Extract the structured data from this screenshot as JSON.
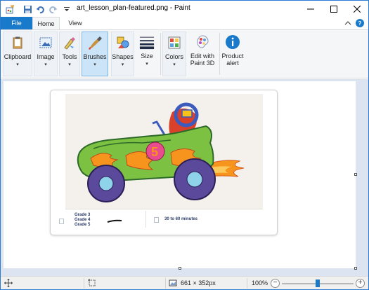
{
  "titlebar": {
    "title": "art_lesson_plan-featured.png - Paint",
    "icons": [
      "paint-app-icon",
      "save-icon",
      "undo-icon",
      "redo-icon",
      "customize-quick-access-icon"
    ],
    "window_buttons": [
      "minimize-icon",
      "maximize-icon",
      "close-icon"
    ]
  },
  "tabs": {
    "file": "File",
    "home": "Home",
    "view": "View"
  },
  "ribbon": {
    "clipboard": "Clipboard",
    "image": "Image",
    "tools": "Tools",
    "brushes": "Brushes",
    "shapes": "Shapes",
    "size": "Size",
    "colors": "Colors",
    "edit_with_paint3d_line1": "Edit with",
    "edit_with_paint3d_line2": "Paint 3D",
    "product_alert_line1": "Product",
    "product_alert_line2": "alert",
    "caret": "▾"
  },
  "card": {
    "grades": [
      "Grade 3",
      "Grade 4",
      "Grade 5"
    ],
    "duration": "30 to 60 minutes",
    "car_number": "5"
  },
  "statusbar": {
    "image_size": "661 × 352px",
    "zoom": "100%",
    "zoom_level": 0.5
  },
  "colors": {
    "accent": "#1979ca",
    "car_green": "#7dc142",
    "flame_orange": "#f7941d",
    "wheel_purple": "#5b4a9b",
    "helmet_blue": "#3b5bbf",
    "driver_red": "#d9412b"
  }
}
